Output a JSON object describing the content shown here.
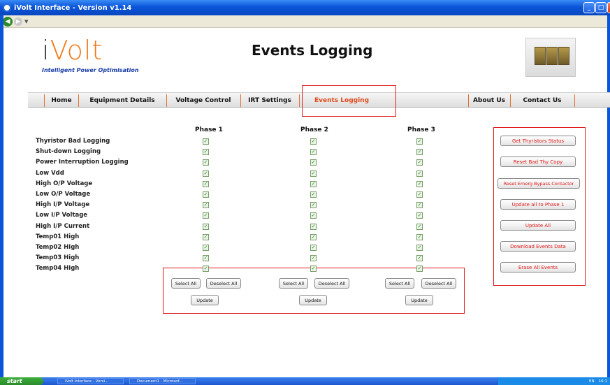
{
  "window": {
    "title": "iVolt Interface - Version v1.14"
  },
  "header": {
    "logo_text": "Volt",
    "logo_i": "i",
    "tagline": "Intelligent Power Optimisation",
    "page_title": "Events Logging"
  },
  "menu": {
    "items": [
      "Home",
      "Equipment Details",
      "Voltage Control",
      "IRT Settings",
      "Events Logging",
      "About Us",
      "Contact Us"
    ],
    "active": "Events Logging"
  },
  "grid": {
    "phases": [
      "Phase 1",
      "Phase 2",
      "Phase 3"
    ],
    "rows": [
      "Thyristor Bad Logging",
      "Shut-down Logging",
      "Power Interruption Logging",
      "Low Vdd",
      "High O/P Voltage",
      "Low O/P Voltage",
      "High I/P Voltage",
      "Low I/P Voltage",
      "High I/P Current",
      "Temp01 High",
      "Temp02 High",
      "Temp03 High",
      "Temp04 High"
    ],
    "checked": true,
    "select_all_label": "Select All",
    "deselect_all_label": "Deselect All",
    "update_label": "Update"
  },
  "actions": {
    "buttons": [
      "Get Thyristors Status",
      "Reset Bad Thy Copy",
      "Reset Emerg Bypass Contactor",
      "Update all to Phase 1",
      "Update All",
      "Download Events Data",
      "Erase All Events"
    ],
    "accent_color": "#e01818"
  },
  "taskbar": {
    "start_label": "start",
    "tasks": [
      "iVolt Interface - Versi...",
      "Document1 - Microsof..."
    ],
    "tray_lang": "EN",
    "clock": "16:1"
  }
}
